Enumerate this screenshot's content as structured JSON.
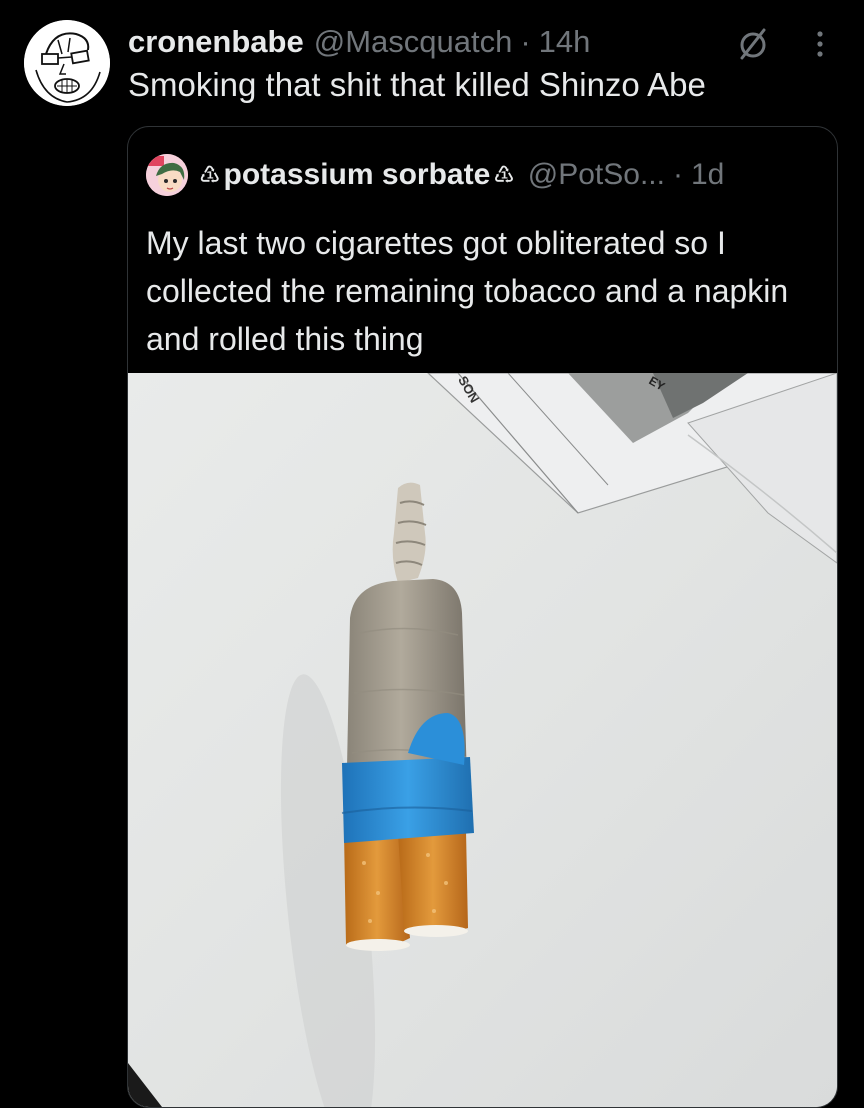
{
  "tweet": {
    "author_name": "cronenbabe",
    "handle": "@Mascquatch",
    "separator": "·",
    "time": "14h",
    "text": "Smoking that shit that killed Shinzo Abe",
    "avatar_icon": "cartoon-face-avatar",
    "grok_icon": "grok-slash-circle-icon",
    "more_icon": "vertical-ellipsis-icon"
  },
  "quoted": {
    "name_prefix_icon": "♳",
    "author_name": "potassium sorbate",
    "name_suffix_icon": "♳",
    "handle": "@PotSo...",
    "separator": "·",
    "time": "1d",
    "text": "My last two cigarettes got obliterated so I collected the remaining tobacco and a napkin and rolled this thing",
    "avatar_icon": "anime-character-avatar",
    "photo": {
      "description_icon": "handrolled-cigarette-photo",
      "paper_text_left": "SON",
      "paper_text_right": "EY"
    }
  },
  "colors": {
    "background": "#000000",
    "text_primary": "#e7e9ea",
    "text_secondary": "#71767b",
    "border": "#2f3336",
    "tape_blue": "#2b8fd9",
    "filter_orange": "#d98a2a"
  }
}
